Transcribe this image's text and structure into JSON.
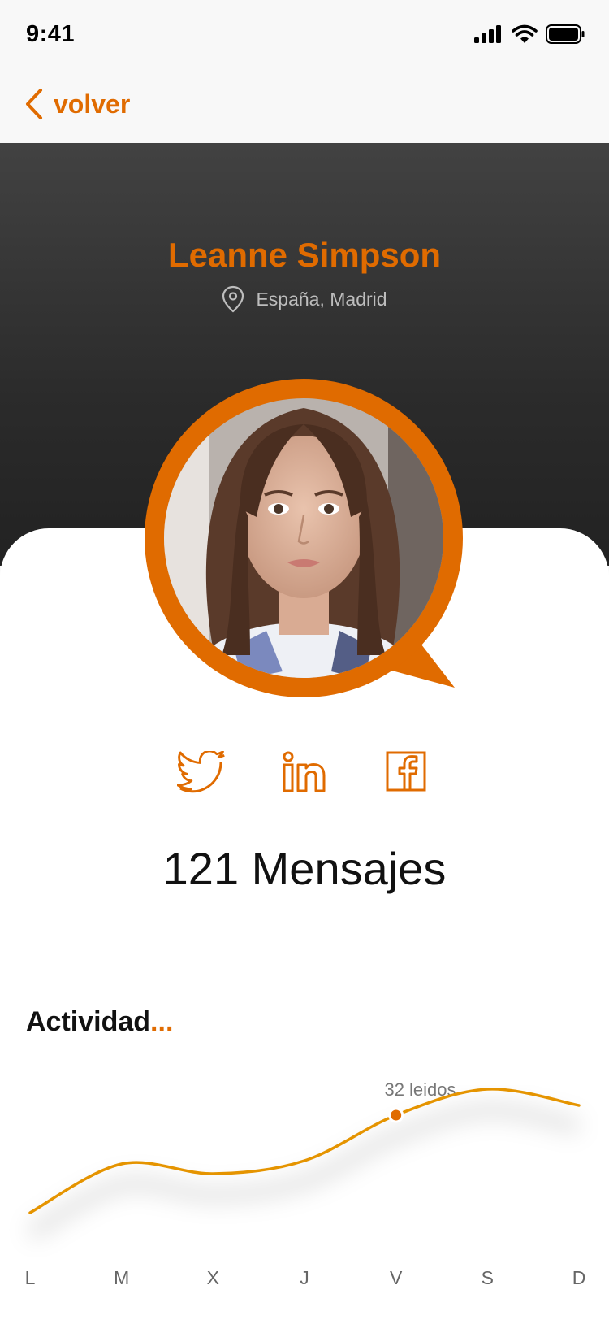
{
  "status": {
    "time": "9:41"
  },
  "nav": {
    "back_label": "volver"
  },
  "profile": {
    "name": "Leanne Simpson",
    "location": "España, Madrid"
  },
  "social": [
    "twitter-icon",
    "linkedin-icon",
    "facebook-icon"
  ],
  "messages": {
    "count": 121,
    "text": "121 Mensajes"
  },
  "activity": {
    "title": "Actividad",
    "title_suffix": "...",
    "peak_label": "32 leidos"
  },
  "chart_data": {
    "type": "line",
    "categories": [
      "L",
      "M",
      "X",
      "J",
      "V",
      "S",
      "D"
    ],
    "series": [
      {
        "values": [
          2,
          17,
          14,
          18,
          32,
          40,
          35
        ]
      }
    ],
    "highlight": {
      "category": "V",
      "value": 32,
      "label": "32 leidos"
    },
    "colors": {
      "line": "#e59400",
      "point": "#e06b00"
    },
    "ylim": [
      0,
      45
    ]
  },
  "colors": {
    "accent": "#e06b00",
    "dark": "#2b2b2b"
  }
}
